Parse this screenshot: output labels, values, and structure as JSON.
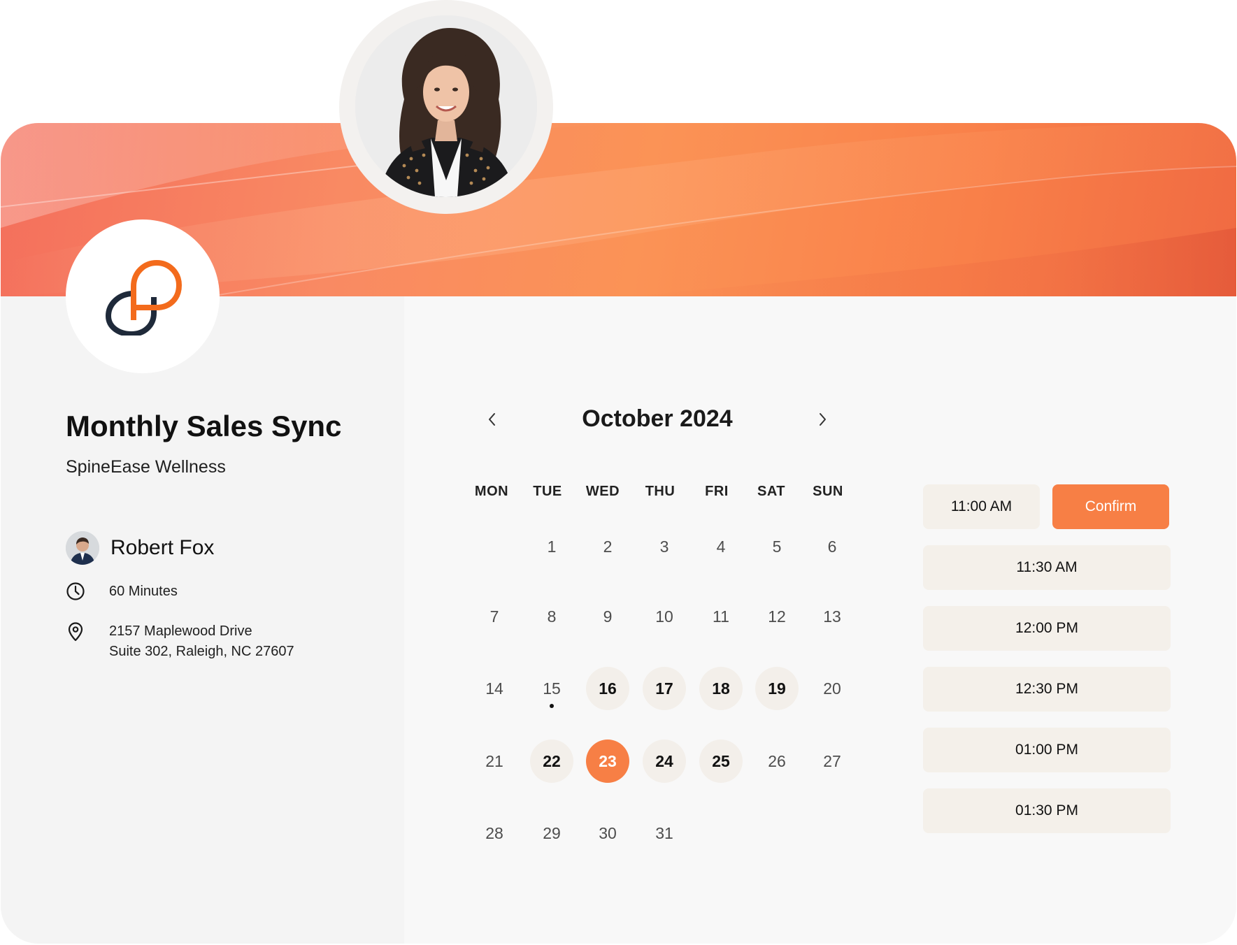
{
  "event": {
    "title": "Monthly Sales Sync",
    "company": "SpineEase Wellness"
  },
  "organizer": {
    "name": "Robert Fox",
    "avatar_icon": "person-avatar"
  },
  "details": {
    "duration": "60 Minutes",
    "address_line1": "2157 Maplewood Drive",
    "address_line2": "Suite 302, Raleigh, NC 27607",
    "duration_icon": "clock-icon",
    "location_icon": "location-pin-icon"
  },
  "calendar": {
    "month_label": "October 2024",
    "prev_icon": "chevron-left-icon",
    "next_icon": "chevron-right-icon",
    "weekdays": [
      "MON",
      "TUE",
      "WED",
      "THU",
      "FRI",
      "SAT",
      "SUN"
    ],
    "days": [
      "1",
      "2",
      "3",
      "4",
      "5",
      "6",
      "7",
      "8",
      "9",
      "10",
      "11",
      "12",
      "13",
      "14",
      "15",
      "16",
      "17",
      "18",
      "19",
      "20",
      "21",
      "22",
      "23",
      "24",
      "25",
      "26",
      "27",
      "28",
      "29",
      "30",
      "31"
    ],
    "available_days": [
      "16",
      "17",
      "18",
      "19",
      "22",
      "24",
      "25"
    ],
    "selected_day": "23",
    "today": "15"
  },
  "time_slots": {
    "selected_time": "11:00 AM",
    "confirm_label": "Confirm",
    "other_times": [
      "11:30 AM",
      "12:00 PM",
      "12:30 PM",
      "01:00 PM",
      "01:30 PM"
    ]
  },
  "colors": {
    "accent": "#f77f45",
    "available_bg": "#f3efea",
    "slot_bg": "#f4f0ea",
    "logo_dark": "#1f2a3a",
    "logo_orange": "#f36b1c"
  }
}
